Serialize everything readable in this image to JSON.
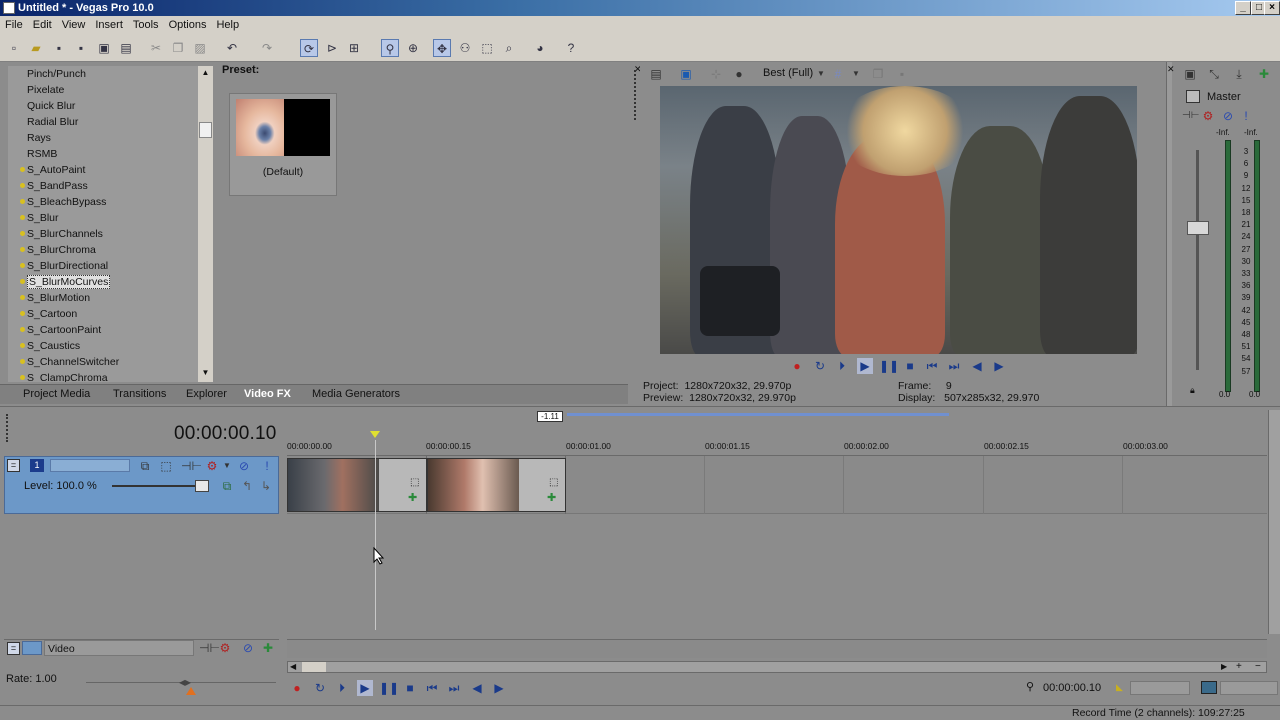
{
  "window": {
    "title": "Untitled * - Vegas Pro 10.0",
    "buttons": [
      "_",
      "□",
      "×"
    ]
  },
  "menu": [
    "File",
    "Edit",
    "View",
    "Insert",
    "Tools",
    "Options",
    "Help"
  ],
  "fx_list": {
    "items": [
      "Pinch/Punch",
      "Pixelate",
      "Quick Blur",
      "Radial Blur",
      "Rays",
      "RSMB",
      "S_AutoPaint",
      "S_BandPass",
      "S_BleachBypass",
      "S_Blur",
      "S_BlurChannels",
      "S_BlurChroma",
      "S_BlurDirectional",
      "S_BlurMoCurves",
      "S_BlurMotion",
      "S_Cartoon",
      "S_CartoonPaint",
      "S_Caustics",
      "S_ChannelSwitcher",
      "S_ClampChroma"
    ],
    "plugin_items": [
      "S_AutoPaint",
      "S_BandPass",
      "S_BleachBypass",
      "S_Blur",
      "S_BlurChannels",
      "S_BlurChroma",
      "S_BlurDirectional",
      "S_BlurMoCurves",
      "S_BlurMotion",
      "S_Cartoon",
      "S_CartoonPaint",
      "S_Caustics",
      "S_ChannelSwitcher",
      "S_ClampChroma"
    ],
    "selected": "S_BlurMoCurves"
  },
  "preset": {
    "label": "Preset:",
    "default_name": "(Default)"
  },
  "dock_tabs": [
    "Project Media",
    "Transitions",
    "Explorer",
    "Video FX",
    "Media Generators"
  ],
  "dock_active_tab": "Video FX",
  "preview": {
    "quality": "Best (Full)",
    "project_label": "Project:",
    "project_value": "1280x720x32, 29.970p",
    "preview_label": "Preview:",
    "preview_value": "1280x720x32, 29.970p",
    "frame_label": "Frame:",
    "frame_value": "9",
    "display_label": "Display:",
    "display_value": "507x285x32, 29.970"
  },
  "master": {
    "label": "Master",
    "peak_left": "-Inf.",
    "peak_right": "-Inf.",
    "scale": [
      "3",
      "6",
      "9",
      "12",
      "15",
      "18",
      "21",
      "24",
      "27",
      "30",
      "33",
      "36",
      "39",
      "42",
      "45",
      "48",
      "51",
      "54",
      "57"
    ],
    "bottom_left": "0.0",
    "bottom_right": "0.0"
  },
  "timeline": {
    "time_display": "00:00:00.10",
    "loop_badge": "-1.11",
    "ruler": [
      "00:00:00.00",
      "00:00:00.15",
      "00:00:01.00",
      "00:00:01.15",
      "00:00:02.00",
      "00:00:02.15",
      "00:00:03.00"
    ],
    "track": {
      "number": "1",
      "level": "Level: 100.0 %"
    },
    "video_bus": "Video",
    "rate": "Rate: 1.00",
    "timecode": "00:00:00.10"
  },
  "status": {
    "record_time": "Record Time (2 channels): 109:27:25"
  },
  "colors": {
    "titlebar_start": "#0a246a",
    "track_header": "#6c98c8",
    "panel_bg": "#8c8c8c",
    "playhead_marker": "#e0e030"
  }
}
